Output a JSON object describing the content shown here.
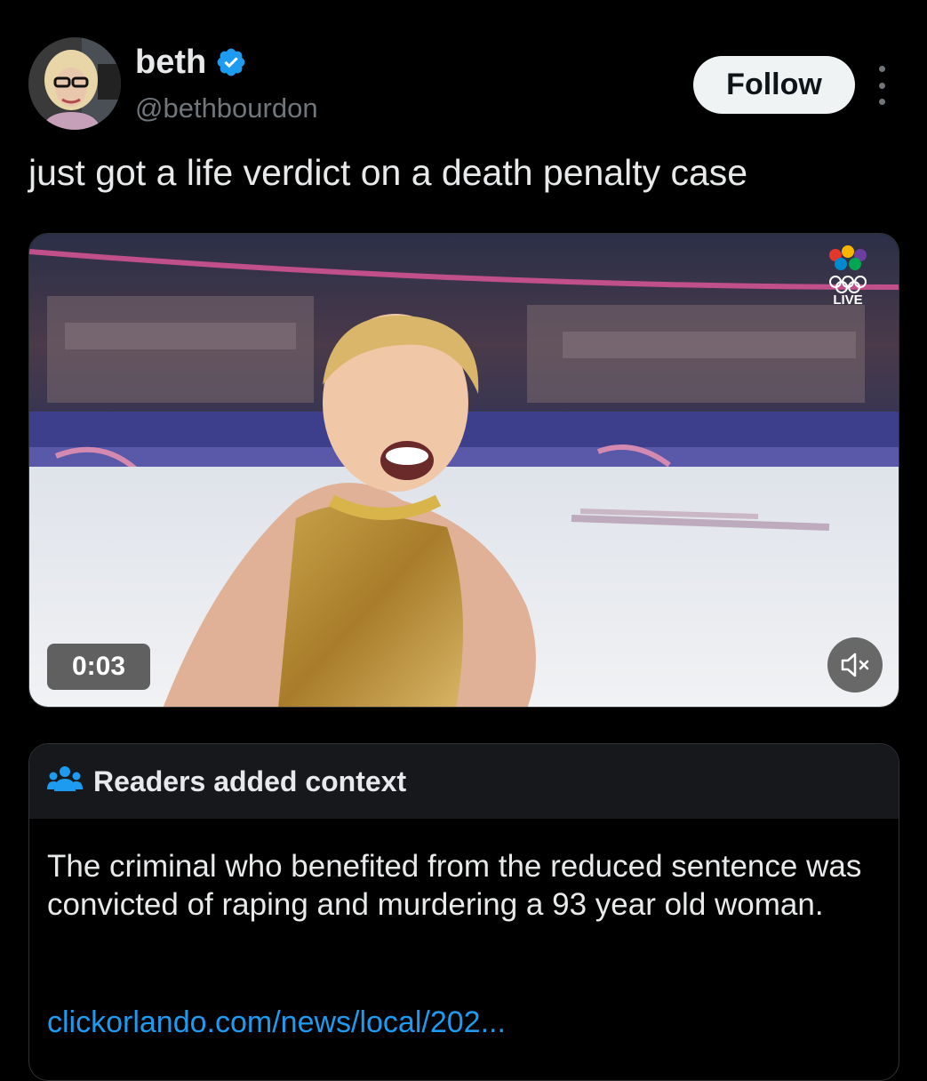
{
  "author": {
    "display_name": "beth",
    "handle": "@bethbourdon",
    "verified": true,
    "avatar_icon": "avatar-icon"
  },
  "actions": {
    "follow_label": "Follow",
    "more_icon": "more-vertical-icon"
  },
  "tweet": {
    "text": "just got a life verdict on a death penalty case"
  },
  "media": {
    "type": "video",
    "time": "0:03",
    "overlay_badge": "LIVE",
    "mute_icon": "muted-speaker-icon"
  },
  "community_note": {
    "title": "Readers added context",
    "icon": "people-icon",
    "body": "The criminal who benefited from the reduced sentence was convicted of raping and murdering a 93 year old woman.",
    "link": "clickorlando.com/news/local/202..."
  },
  "colors": {
    "background": "#000000",
    "text_primary": "#e7e9ea",
    "text_secondary": "#71767b",
    "verified_blue": "#1d9bf0",
    "link_blue": "#1d9bf0",
    "follow_bg": "#eff3f4",
    "note_header_bg": "#16181c",
    "border": "#2f3336"
  }
}
